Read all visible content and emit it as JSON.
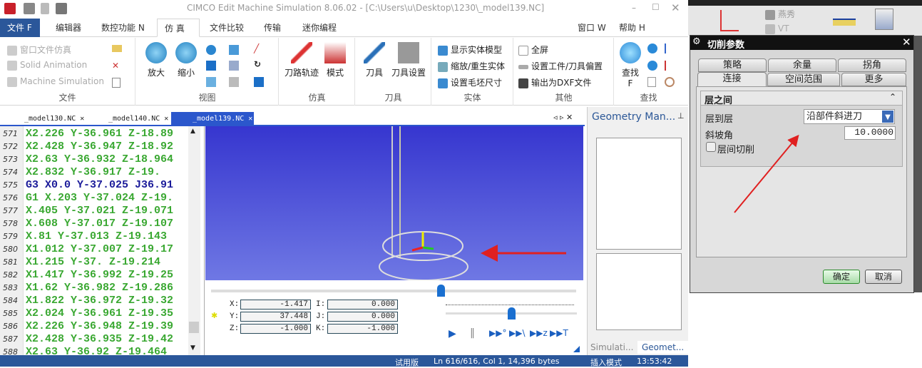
{
  "window": {
    "title": "CIMCO Edit Machine Simulation 8.06.02 - [C:\\Users\\u\\Desktop\\1230\\_model139.NC]"
  },
  "menu": {
    "tabs": [
      "文件 F",
      "编辑器",
      "数控功能 N",
      "仿 真",
      "文件比较",
      "传输",
      "迷你编程"
    ],
    "active": "仿 真",
    "right": [
      "窗口 W",
      "帮助 H"
    ]
  },
  "ribbon": {
    "file": {
      "items": [
        "窗口文件仿真",
        "Solid Animation",
        "Machine Simulation"
      ],
      "label": "文件"
    },
    "view": {
      "zoom_in": "放大",
      "zoom_out": "缩小",
      "label": "视图"
    },
    "sim": {
      "toolpath": "刀路轨迹",
      "mode": "模式",
      "label": "仿真"
    },
    "tool": {
      "tool": "刀具",
      "tool_setup": "刀具设置",
      "label": "刀具"
    },
    "solid": {
      "items": [
        "显示实体模型",
        "缩放/重生实体",
        "设置毛坯尺寸"
      ],
      "label": "实体"
    },
    "other": {
      "items": [
        "全屏",
        "设置工件/刀具偏置",
        "输出为DXF文件"
      ],
      "label": "其他"
    },
    "find": {
      "find": "查找",
      "find_key": "F",
      "label": "查找"
    }
  },
  "doc_tabs": [
    "_model130.NC",
    "_model140.NC",
    "_model139.NC"
  ],
  "editor": {
    "lines": [
      {
        "n": "571",
        "code": "X2.226 Y-36.961 Z-18.89"
      },
      {
        "n": "572",
        "code": "X2.428 Y-36.947 Z-18.92"
      },
      {
        "n": "573",
        "code": "X2.63 Y-36.932 Z-18.964"
      },
      {
        "n": "574",
        "code": "X2.832 Y-36.917 Z-19."
      },
      {
        "n": "575",
        "code": "G3 X0.0 Y-37.025 J36.91"
      },
      {
        "n": "576",
        "code": "G1 X.203 Y-37.024 Z-19."
      },
      {
        "n": "577",
        "code": "X.405 Y-37.021 Z-19.071"
      },
      {
        "n": "578",
        "code": "X.608 Y-37.017 Z-19.107"
      },
      {
        "n": "579",
        "code": "X.81 Y-37.013 Z-19.143"
      },
      {
        "n": "580",
        "code": "X1.012 Y-37.007 Z-19.17"
      },
      {
        "n": "581",
        "code": "X1.215 Y-37. Z-19.214"
      },
      {
        "n": "582",
        "code": "X1.417 Y-36.992 Z-19.25"
      },
      {
        "n": "583",
        "code": "X1.62 Y-36.982 Z-19.286"
      },
      {
        "n": "584",
        "code": "X1.822 Y-36.972 Z-19.32"
      },
      {
        "n": "585",
        "code": "X2.024 Y-36.961 Z-19.35"
      },
      {
        "n": "586",
        "code": "X2.226 Y-36.948 Z-19.39"
      },
      {
        "n": "587",
        "code": "X2.428 Y-36.935 Z-19.42"
      },
      {
        "n": "588",
        "code": "X2.63 Y-36.92 Z-19.464"
      }
    ]
  },
  "coords": {
    "X": "-1.417",
    "Y": "37.448",
    "Z": "-1.000",
    "I": "0.000",
    "J": "0.000",
    "K": "-1.000"
  },
  "right_panel": {
    "title": "Geometry Man...",
    "tabs": [
      "Simulati...",
      "Geomet..."
    ]
  },
  "status": {
    "trial": "试用版",
    "position": "Ln 616/616, Col 1, 14,396 bytes",
    "mode": "插入模式",
    "time": "13:53:42"
  },
  "nx_toolbar": {
    "items": [
      "燕秀",
      "VT"
    ]
  },
  "dialog": {
    "title": "切削参数",
    "tabs_row1": [
      "策略",
      "余量",
      "拐角"
    ],
    "tabs_row2": [
      "连接",
      "空间范围",
      "更多"
    ],
    "active_tab": "连接",
    "group": "层之间",
    "layer_to_layer_label": "层到层",
    "layer_to_layer_value": "沿部件斜进刀",
    "ramp_angle_label": "斜坡角",
    "ramp_angle_value": "10.0000",
    "interlayer_cut_label": "层间切削",
    "ok": "确定",
    "cancel": "取消"
  },
  "colors": {
    "accent": "#2b579a",
    "code_green": "#3aa832",
    "code_arc": "#1b1b9a",
    "annotation_arrow": "#e02020"
  }
}
